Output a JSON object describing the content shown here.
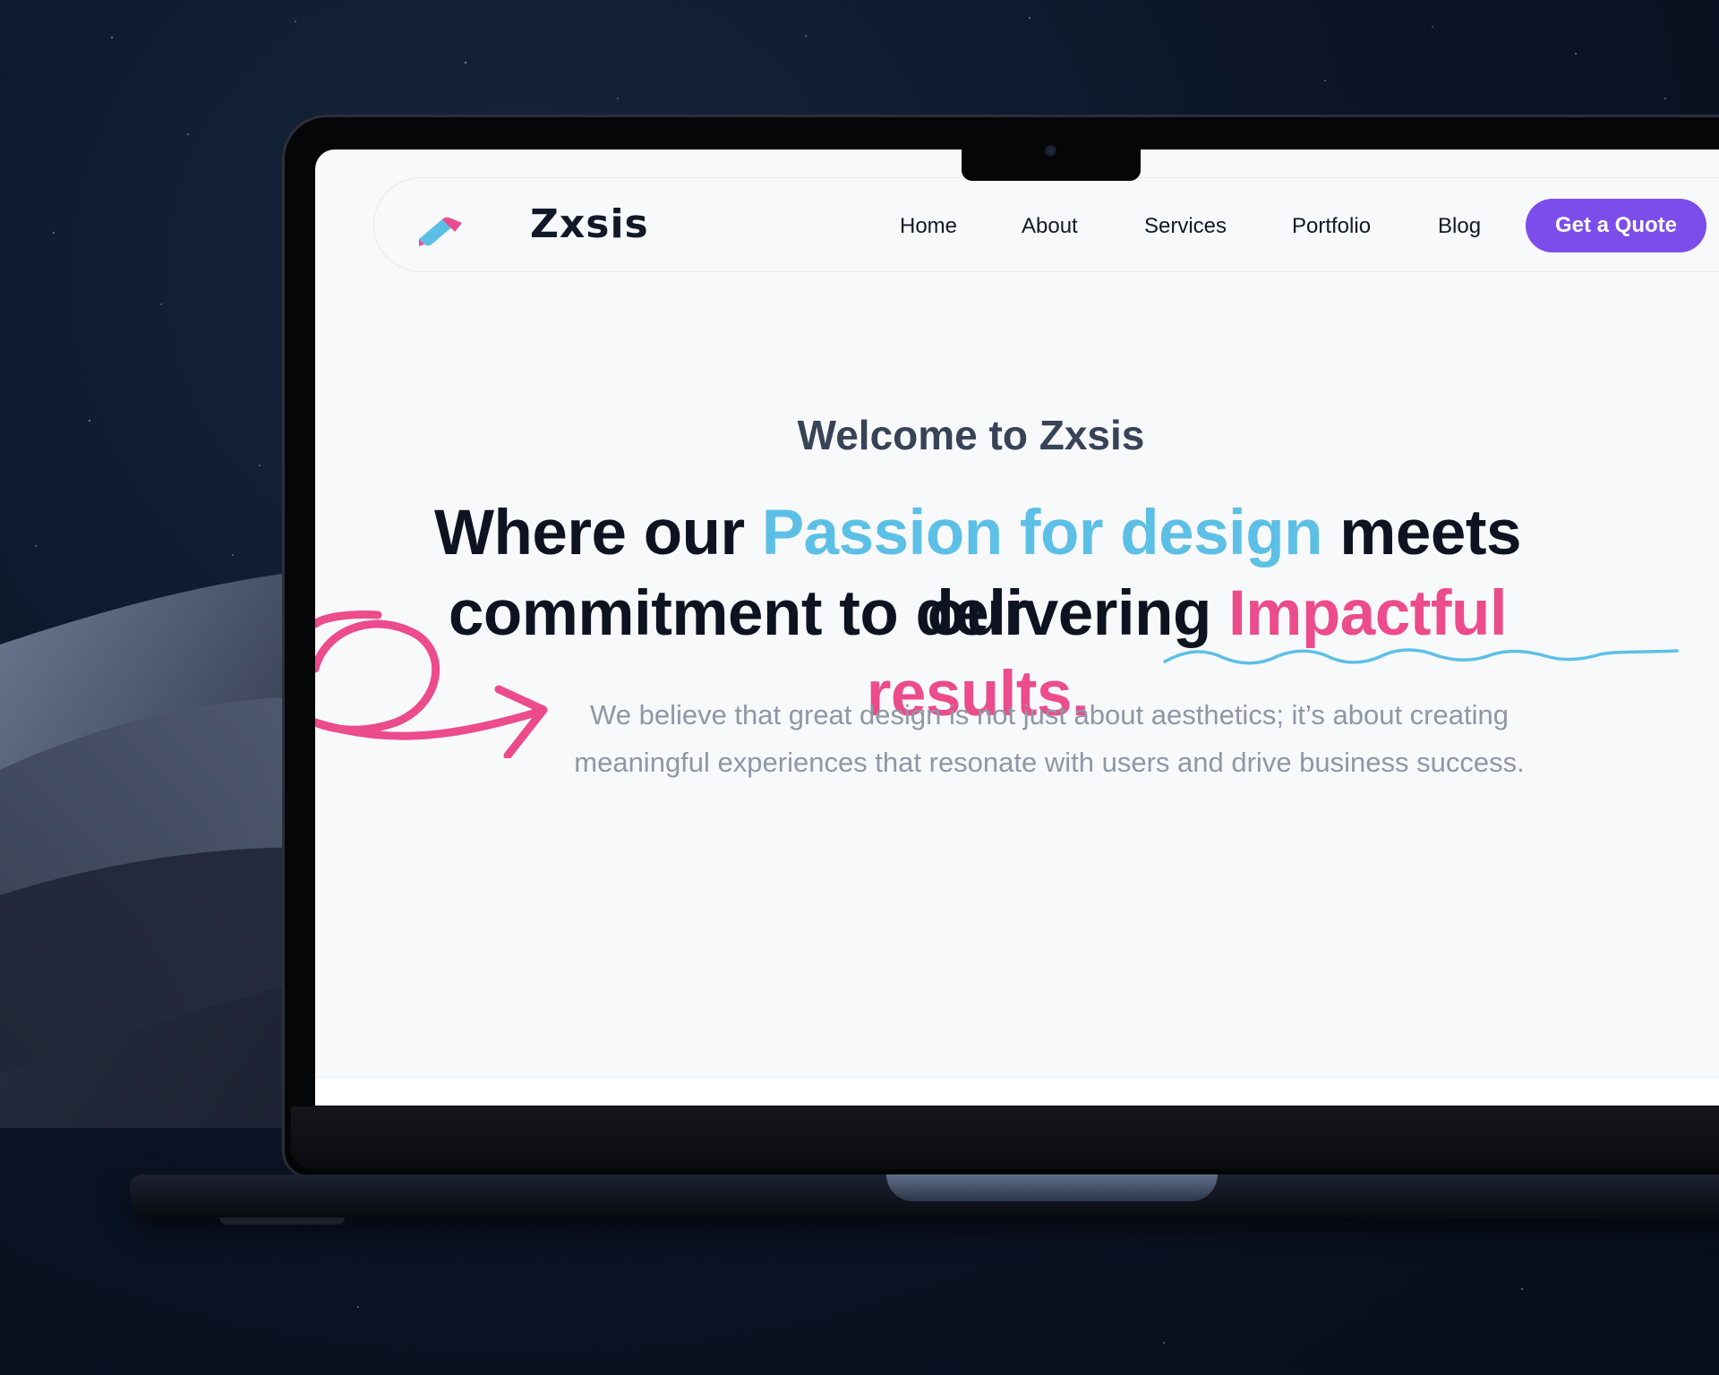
{
  "site": {
    "brand": "Zxsis",
    "nav": {
      "home": "Home",
      "about": "About",
      "services": "Services",
      "portfolio": "Portfolio",
      "blog": "Blog",
      "cta": "Get a Quote"
    }
  },
  "hero": {
    "welcome": "Welcome to Zxsis",
    "line1_a": "Where our ",
    "line1_highlight": "Passion for design",
    "line1_b": " meets our",
    "line2_a": "commitment to delivering ",
    "line2_highlight": "Impactful results.",
    "sub_line1": "We believe that great design is not just about aesthetics; it’s about creating",
    "sub_line2": "meaningful experiences that resonate with users and drive business success."
  },
  "colors": {
    "accent_blue": "#5cc0e6",
    "accent_pink": "#ec4b8c",
    "cta_purple": "#7c4dea",
    "heading": "#0d1321"
  },
  "icons": {
    "logo": "brand-logo-icon",
    "decor_arrow": "swirl-arrow-icon",
    "decor_underline": "wavy-underline-icon"
  }
}
